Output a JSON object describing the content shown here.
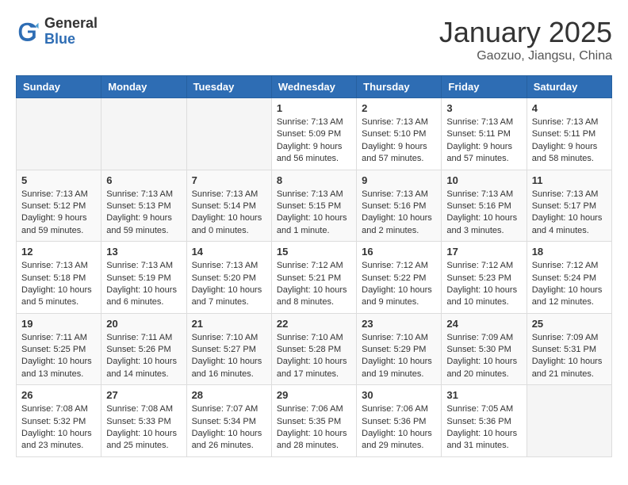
{
  "logo": {
    "general": "General",
    "blue": "Blue"
  },
  "header": {
    "title": "January 2025",
    "subtitle": "Gaozuo, Jiangsu, China"
  },
  "weekdays": [
    "Sunday",
    "Monday",
    "Tuesday",
    "Wednesday",
    "Thursday",
    "Friday",
    "Saturday"
  ],
  "weeks": [
    [
      {
        "day": "",
        "info": ""
      },
      {
        "day": "",
        "info": ""
      },
      {
        "day": "",
        "info": ""
      },
      {
        "day": "1",
        "info": "Sunrise: 7:13 AM\nSunset: 5:09 PM\nDaylight: 9 hours\nand 56 minutes."
      },
      {
        "day": "2",
        "info": "Sunrise: 7:13 AM\nSunset: 5:10 PM\nDaylight: 9 hours\nand 57 minutes."
      },
      {
        "day": "3",
        "info": "Sunrise: 7:13 AM\nSunset: 5:11 PM\nDaylight: 9 hours\nand 57 minutes."
      },
      {
        "day": "4",
        "info": "Sunrise: 7:13 AM\nSunset: 5:11 PM\nDaylight: 9 hours\nand 58 minutes."
      }
    ],
    [
      {
        "day": "5",
        "info": "Sunrise: 7:13 AM\nSunset: 5:12 PM\nDaylight: 9 hours\nand 59 minutes."
      },
      {
        "day": "6",
        "info": "Sunrise: 7:13 AM\nSunset: 5:13 PM\nDaylight: 9 hours\nand 59 minutes."
      },
      {
        "day": "7",
        "info": "Sunrise: 7:13 AM\nSunset: 5:14 PM\nDaylight: 10 hours\nand 0 minutes."
      },
      {
        "day": "8",
        "info": "Sunrise: 7:13 AM\nSunset: 5:15 PM\nDaylight: 10 hours\nand 1 minute."
      },
      {
        "day": "9",
        "info": "Sunrise: 7:13 AM\nSunset: 5:16 PM\nDaylight: 10 hours\nand 2 minutes."
      },
      {
        "day": "10",
        "info": "Sunrise: 7:13 AM\nSunset: 5:16 PM\nDaylight: 10 hours\nand 3 minutes."
      },
      {
        "day": "11",
        "info": "Sunrise: 7:13 AM\nSunset: 5:17 PM\nDaylight: 10 hours\nand 4 minutes."
      }
    ],
    [
      {
        "day": "12",
        "info": "Sunrise: 7:13 AM\nSunset: 5:18 PM\nDaylight: 10 hours\nand 5 minutes."
      },
      {
        "day": "13",
        "info": "Sunrise: 7:13 AM\nSunset: 5:19 PM\nDaylight: 10 hours\nand 6 minutes."
      },
      {
        "day": "14",
        "info": "Sunrise: 7:13 AM\nSunset: 5:20 PM\nDaylight: 10 hours\nand 7 minutes."
      },
      {
        "day": "15",
        "info": "Sunrise: 7:12 AM\nSunset: 5:21 PM\nDaylight: 10 hours\nand 8 minutes."
      },
      {
        "day": "16",
        "info": "Sunrise: 7:12 AM\nSunset: 5:22 PM\nDaylight: 10 hours\nand 9 minutes."
      },
      {
        "day": "17",
        "info": "Sunrise: 7:12 AM\nSunset: 5:23 PM\nDaylight: 10 hours\nand 10 minutes."
      },
      {
        "day": "18",
        "info": "Sunrise: 7:12 AM\nSunset: 5:24 PM\nDaylight: 10 hours\nand 12 minutes."
      }
    ],
    [
      {
        "day": "19",
        "info": "Sunrise: 7:11 AM\nSunset: 5:25 PM\nDaylight: 10 hours\nand 13 minutes."
      },
      {
        "day": "20",
        "info": "Sunrise: 7:11 AM\nSunset: 5:26 PM\nDaylight: 10 hours\nand 14 minutes."
      },
      {
        "day": "21",
        "info": "Sunrise: 7:10 AM\nSunset: 5:27 PM\nDaylight: 10 hours\nand 16 minutes."
      },
      {
        "day": "22",
        "info": "Sunrise: 7:10 AM\nSunset: 5:28 PM\nDaylight: 10 hours\nand 17 minutes."
      },
      {
        "day": "23",
        "info": "Sunrise: 7:10 AM\nSunset: 5:29 PM\nDaylight: 10 hours\nand 19 minutes."
      },
      {
        "day": "24",
        "info": "Sunrise: 7:09 AM\nSunset: 5:30 PM\nDaylight: 10 hours\nand 20 minutes."
      },
      {
        "day": "25",
        "info": "Sunrise: 7:09 AM\nSunset: 5:31 PM\nDaylight: 10 hours\nand 21 minutes."
      }
    ],
    [
      {
        "day": "26",
        "info": "Sunrise: 7:08 AM\nSunset: 5:32 PM\nDaylight: 10 hours\nand 23 minutes."
      },
      {
        "day": "27",
        "info": "Sunrise: 7:08 AM\nSunset: 5:33 PM\nDaylight: 10 hours\nand 25 minutes."
      },
      {
        "day": "28",
        "info": "Sunrise: 7:07 AM\nSunset: 5:34 PM\nDaylight: 10 hours\nand 26 minutes."
      },
      {
        "day": "29",
        "info": "Sunrise: 7:06 AM\nSunset: 5:35 PM\nDaylight: 10 hours\nand 28 minutes."
      },
      {
        "day": "30",
        "info": "Sunrise: 7:06 AM\nSunset: 5:36 PM\nDaylight: 10 hours\nand 29 minutes."
      },
      {
        "day": "31",
        "info": "Sunrise: 7:05 AM\nSunset: 5:36 PM\nDaylight: 10 hours\nand 31 minutes."
      },
      {
        "day": "",
        "info": ""
      }
    ]
  ]
}
